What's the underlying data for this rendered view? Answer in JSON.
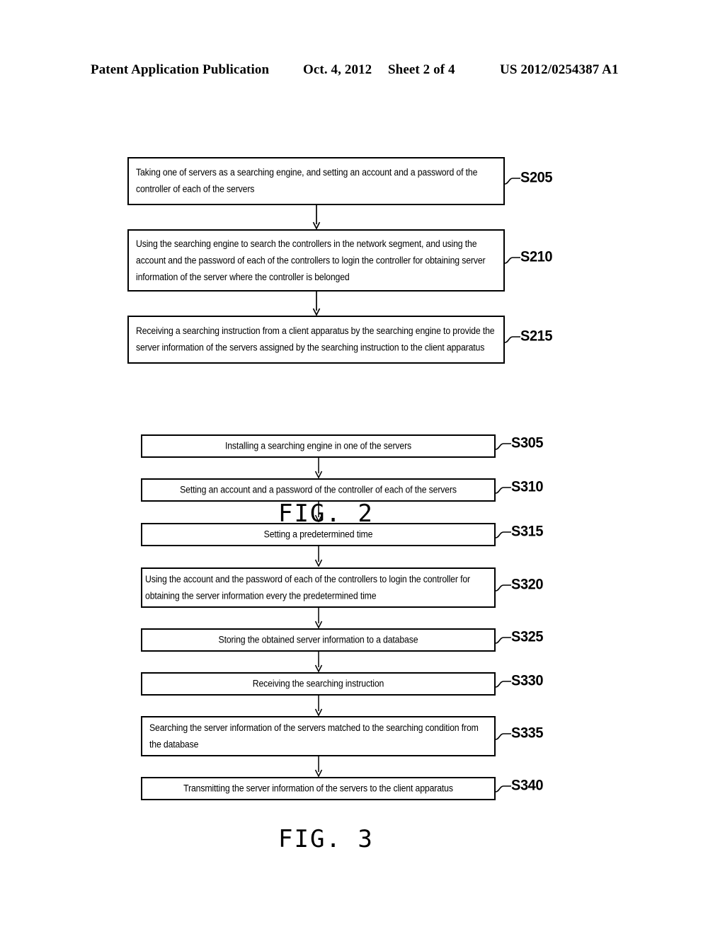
{
  "header": {
    "publication": "Patent Application Publication",
    "date": "Oct. 4, 2012",
    "sheet": "Sheet 2 of 4",
    "publication_number": "US 2012/0254387 A1"
  },
  "figures": [
    {
      "caption": "FIG. 2",
      "steps": [
        {
          "label": "S205",
          "text": "Taking one of servers as a searching engine, and setting an account and a password of the controller of each of the servers"
        },
        {
          "label": "S210",
          "text": "Using the searching engine to search the controllers in the network segment, and using the account and the password of each of the controllers to login the controller for obtaining server information of the server where the controller is belonged"
        },
        {
          "label": "S215",
          "text": "Receiving a searching instruction from a client apparatus by the searching engine to provide the server information of the servers assigned by the searching instruction to the client apparatus"
        }
      ]
    },
    {
      "caption": "FIG. 3",
      "steps": [
        {
          "label": "S305",
          "text": "Installing a searching engine in one of the servers"
        },
        {
          "label": "S310",
          "text": "Setting an account and a password of the controller of each of the servers"
        },
        {
          "label": "S315",
          "text": "Setting a predetermined time"
        },
        {
          "label": "S320",
          "text": "Using the account and the password of each of the controllers to login the controller for obtaining the server information every the predetermined time"
        },
        {
          "label": "S325",
          "text": "Storing the obtained server information to a database"
        },
        {
          "label": "S330",
          "text": "Receiving the searching instruction"
        },
        {
          "label": "S335",
          "text": "Searching the server information of the servers matched to the searching condition from the database"
        },
        {
          "label": "S340",
          "text": "Transmitting the server information of the servers to the client apparatus"
        }
      ]
    }
  ],
  "colors": {
    "ink": "#000000",
    "paper": "#ffffff"
  }
}
